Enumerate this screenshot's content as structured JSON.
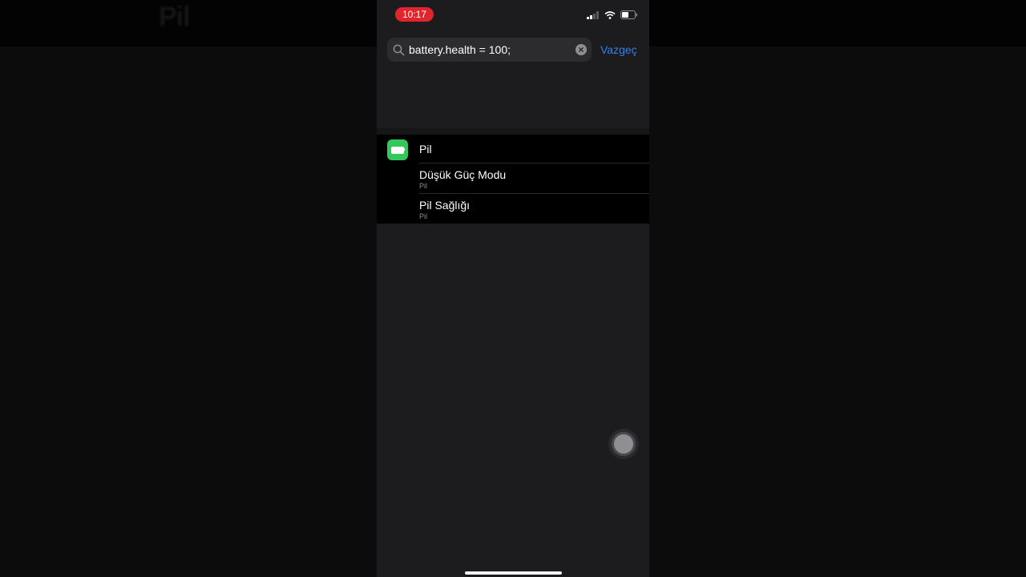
{
  "background": {
    "ghost_title": "Pil"
  },
  "status_bar": {
    "time": "10:17",
    "time_pill_color": "#e0262c",
    "icons": [
      "cellular-signal-icon",
      "wifi-icon",
      "battery-icon"
    ]
  },
  "search": {
    "value": "battery.health = 100;",
    "cancel_label": "Vazgeç",
    "accent_color": "#2f80ed"
  },
  "results": {
    "section_title": "Pil",
    "section_icon": "battery-app-icon",
    "section_icon_color": "#34c759",
    "items": [
      {
        "label": "Düşük Güç Modu",
        "sub": "Pil"
      },
      {
        "label": "Pil Sağlığı",
        "sub": "Pil"
      }
    ]
  }
}
